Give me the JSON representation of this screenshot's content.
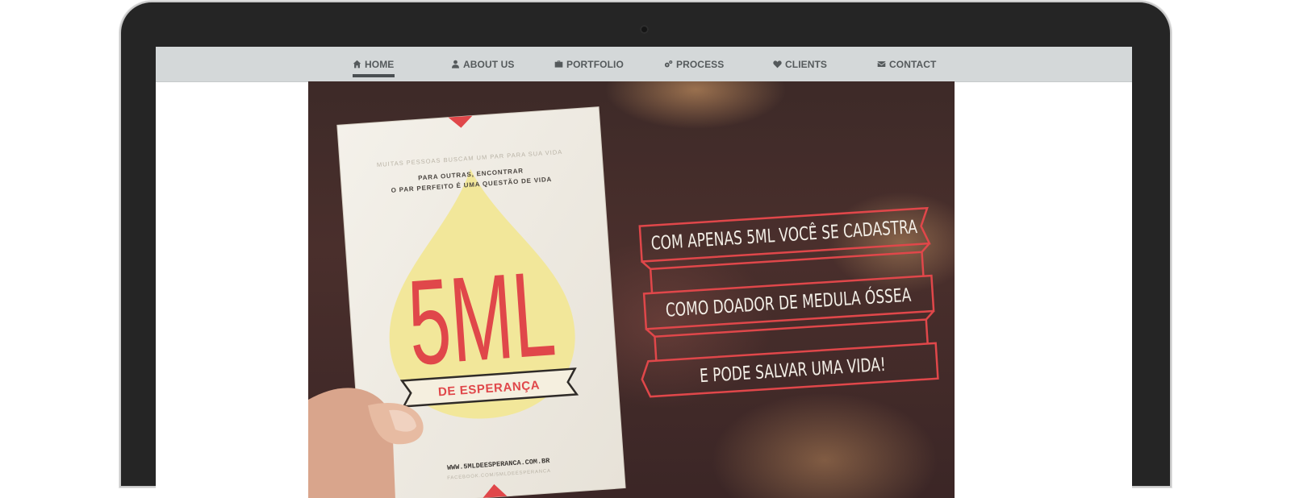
{
  "nav": {
    "items": [
      {
        "label": "HOME",
        "icon": "home-icon",
        "active": true
      },
      {
        "label": "ABOUT US",
        "icon": "user-icon"
      },
      {
        "label": "PORTFOLIO",
        "icon": "briefcase-icon"
      },
      {
        "label": "PROCESS",
        "icon": "gears-icon"
      },
      {
        "label": "CLIENTS",
        "icon": "heart-icon"
      },
      {
        "label": "CONTACT",
        "icon": "envelope-icon"
      }
    ]
  },
  "hero": {
    "card": {
      "top_line": "MUITAS PESSOAS BUSCAM UM PAR PARA SUA VIDA",
      "line1": "PARA OUTRAS, ENCONTRAR",
      "line2": "O PAR PERFEITO É UMA QUESTÃO DE VIDA",
      "big_text": "5ML",
      "ribbon_text": "DE ESPERANÇA",
      "url": "WWW.5MLDEESPERANCA.COM.BR",
      "sub_url": "FACEBOOK.COM/5MLDEESPERANCA"
    },
    "banners": [
      "COM APENAS 5ML VOCÊ SE CADASTRA",
      "COMO DOADOR DE MEDULA ÓSSEA",
      "E PODE SALVAR UMA VIDA!"
    ]
  },
  "colors": {
    "nav_bg": "#d4d8d9",
    "nav_text": "#555a5c",
    "accent_red": "#e0474a",
    "card_yellow": "#f2e79a"
  }
}
